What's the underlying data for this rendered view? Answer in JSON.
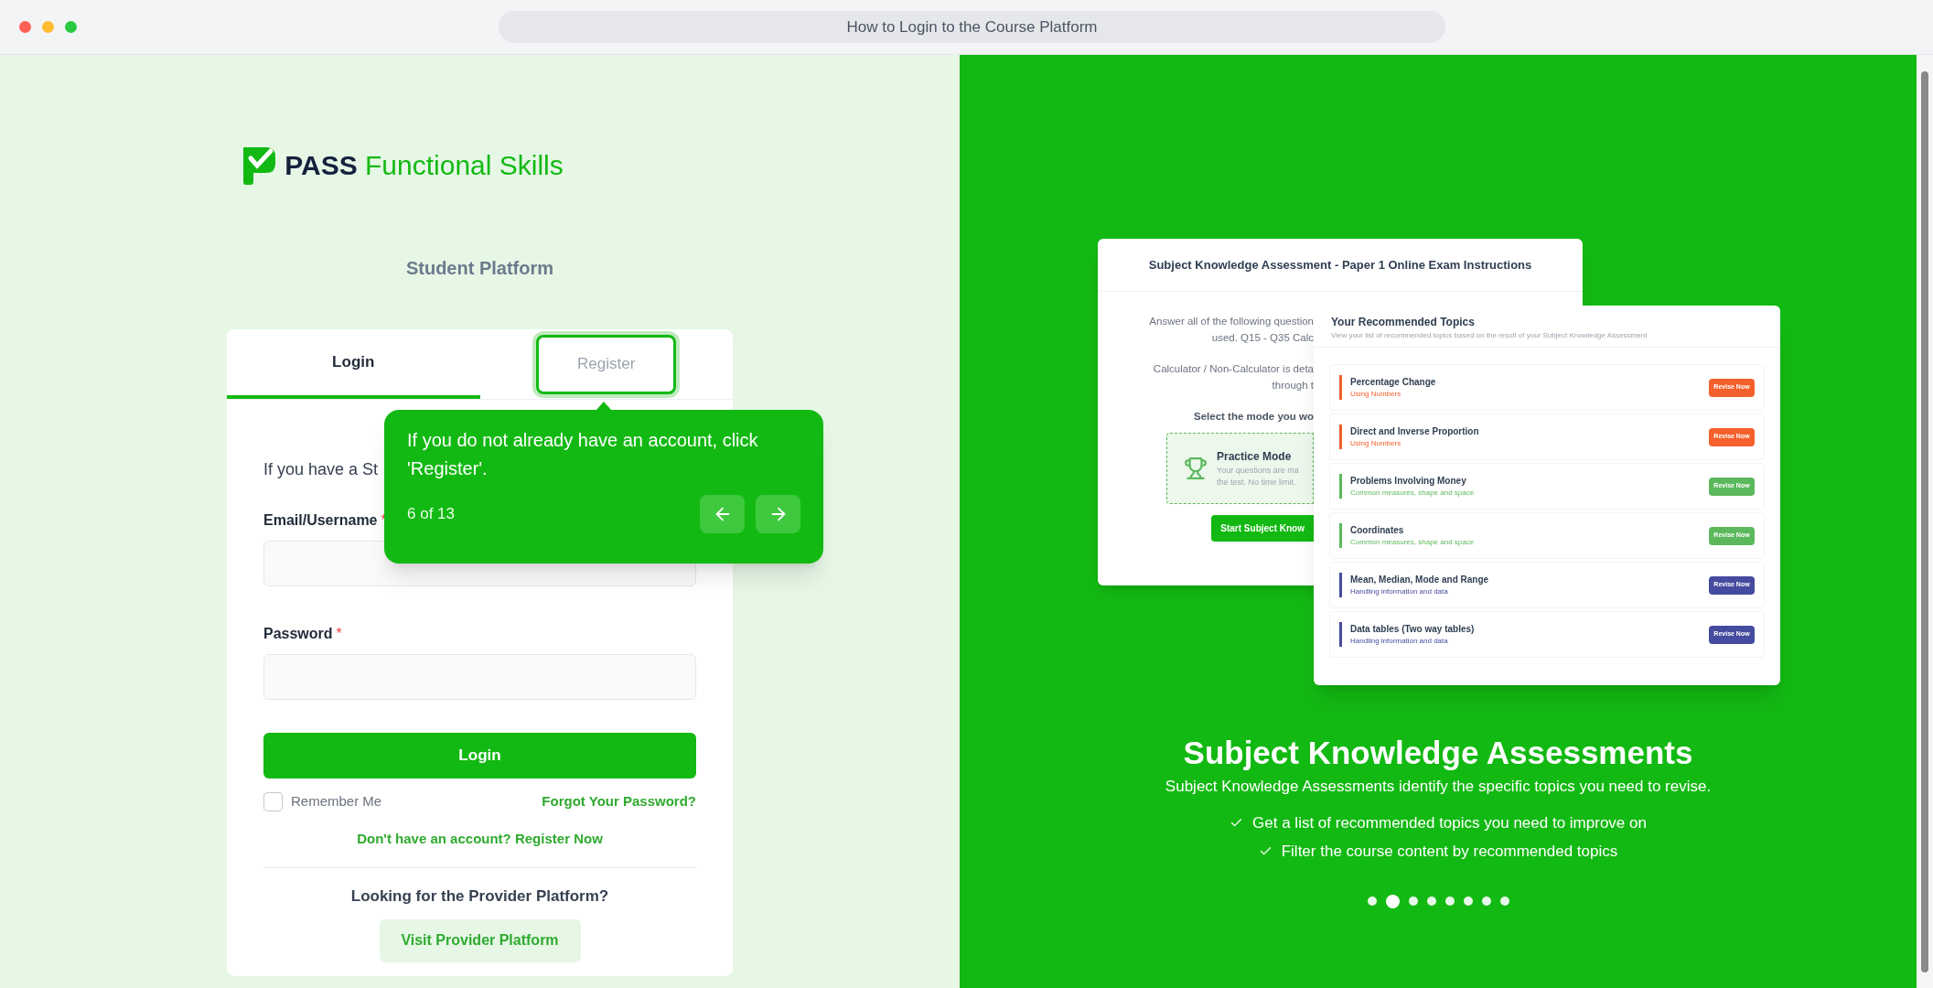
{
  "window": {
    "title": "How to Login to the Course Platform"
  },
  "logo": {
    "bold": "PASS",
    "rest": "Functional Skills"
  },
  "platform_title": "Student Platform",
  "tabs": [
    {
      "label": "Login",
      "selected": true,
      "highlighted": false
    },
    {
      "label": "Register",
      "selected": false,
      "highlighted": true
    }
  ],
  "intro": "If you have a St",
  "fields": [
    {
      "label": "Email/Username",
      "required": "*"
    },
    {
      "label": "Password",
      "required": "*"
    }
  ],
  "login_button": "Login",
  "remember": {
    "label": "Remember Me",
    "checked": false
  },
  "forgot_link": "Forgot Your Password?",
  "register_link": "Don't have an account? Register Now",
  "provider": {
    "question": "Looking for the Provider Platform?",
    "button": "Visit Provider Platform"
  },
  "tour": {
    "text": "If you do not already have an account, click 'Register'.",
    "step": "6 of 13"
  },
  "mockup": {
    "exam_card": {
      "title": "Subject Knowledge Assessment - Paper 1 Online Exam Instructions",
      "lines": [
        "Answer all of the following question",
        "used. Q15 - Q35 Calc",
        "Calculator / Non-Calculator is deta",
        "through t",
        "Select the mode you wo"
      ],
      "mode_title": "Practice Mode",
      "mode_lines": [
        "Your questions are ma",
        "the test. No time limit."
      ],
      "start_button": "Start Subject Know"
    },
    "topics_card": {
      "title": "Your Recommended Topics",
      "subtitle": "View your list of recommended topics based on the result of your  Subject Knowledge Assessment",
      "rows": [
        {
          "title": "Percentage Change",
          "category": "Using Numbers",
          "button": "Revise Now",
          "color": "#f4602b"
        },
        {
          "title": "Direct and Inverse Proportion",
          "category": "Using Numbers",
          "button": "Revise Now",
          "color": "#f4602b"
        },
        {
          "title": "Problems Involving Money",
          "category": "Common measures, shape and space",
          "button": "Revise Now",
          "color": "#5cb85c"
        },
        {
          "title": "Coordinates",
          "category": "Common measures, shape and space",
          "button": "Revise Now",
          "color": "#5cb85c"
        },
        {
          "title": "Mean, Median, Mode and Range",
          "category": "Handling information and data",
          "button": "Revise Now",
          "color": "#454b9f"
        },
        {
          "title": "Data tables (Two way tables)",
          "category": "Handling information and data",
          "button": "Revise Now",
          "color": "#454b9f"
        }
      ]
    }
  },
  "slide": {
    "heading": "Subject Knowledge Assessments",
    "description": "Subject Knowledge Assessments identify the specific topics you need to revise.",
    "bullets": [
      "Get a list of recommended topics you need to improve on",
      "Filter the course content by recommended topics"
    ]
  },
  "carousel_dots": [
    {
      "selected": false
    },
    {
      "selected": true
    },
    {
      "selected": false
    },
    {
      "selected": false
    },
    {
      "selected": false
    },
    {
      "selected": false
    },
    {
      "selected": false
    },
    {
      "selected": false
    }
  ]
}
